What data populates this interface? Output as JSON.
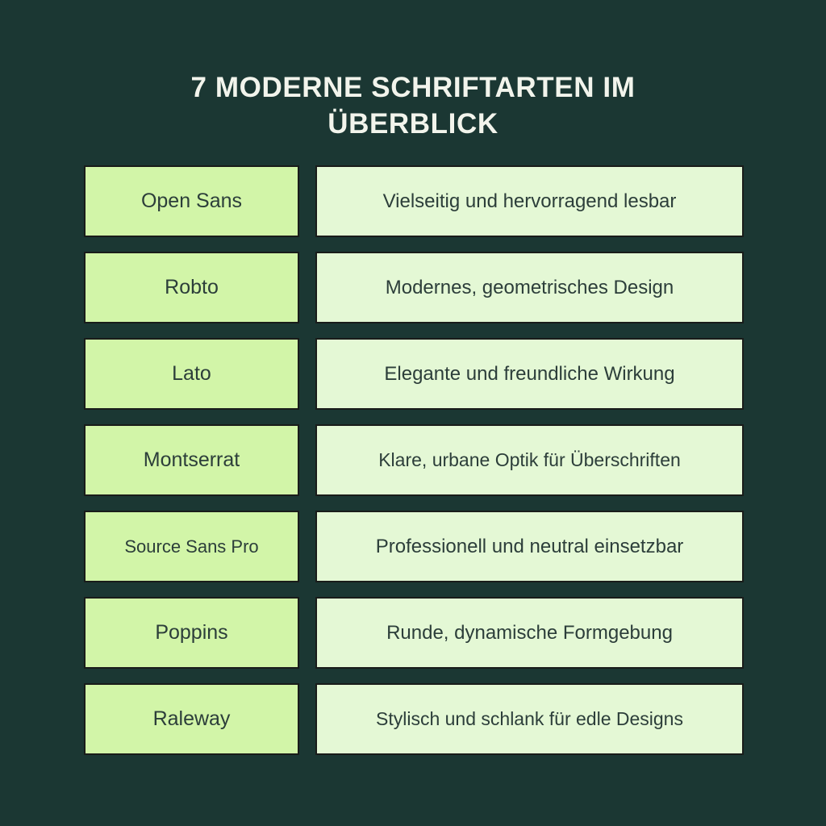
{
  "theme": {
    "background": "#1b3733",
    "title_color": "#f2f4ec",
    "name_cell_fill": "#d2f5a8",
    "desc_cell_fill": "#e4f8d5",
    "cell_border": "#191c1a",
    "cell_text_color": "#2c3e3a"
  },
  "header": {
    "title": "7 Moderne Schriftarten im\nÜberblick"
  },
  "table": {
    "rows": [
      {
        "name": "Open Sans",
        "description": "Vielseitig und hervorragend lesbar"
      },
      {
        "name": "Robto",
        "description": "Modernes, geometrisches Design"
      },
      {
        "name": "Lato",
        "description": "Elegante und freundliche Wirkung"
      },
      {
        "name": "Montserrat",
        "description": "Klare, urbane Optik für Überschriften"
      },
      {
        "name": "Source Sans Pro",
        "description": "Professionell und neutral einsetzbar"
      },
      {
        "name": "Poppins",
        "description": "Runde, dynamische Formgebung"
      },
      {
        "name": "Raleway",
        "description": "Stylisch und schlank für edle Designs"
      }
    ]
  }
}
